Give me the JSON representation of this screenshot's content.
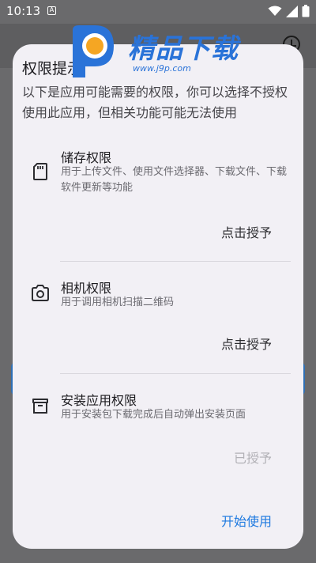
{
  "status_bar": {
    "time": "10:13",
    "notification": "A"
  },
  "watermark": {
    "text": "精品下载",
    "url": "www.j9p.com"
  },
  "dialog": {
    "title": "权限提示",
    "description": "以下是应用可能需要的权限，你可以选择不授权使用此应用，但相关功能可能无法使用",
    "permissions": [
      {
        "icon": "sd-card-icon",
        "title": "储存权限",
        "description": "用于上传文件、使用文件选择器、下载文件、下载软件更新等功能",
        "action": "点击授予"
      },
      {
        "icon": "camera-icon",
        "title": "相机权限",
        "description": "用于调用相机扫描二维码",
        "action": "点击授予"
      },
      {
        "icon": "package-icon",
        "title": "安装应用权限",
        "description": "用于安装包下载完成后自动弹出安装页面",
        "action": "已授予"
      }
    ],
    "start_button": "开始使用"
  },
  "colors": {
    "accent": "#1f7ae0",
    "dialog_bg": "#f2f0f5",
    "scrim": "#6a6a6c",
    "disabled": "#b2b1b6"
  }
}
